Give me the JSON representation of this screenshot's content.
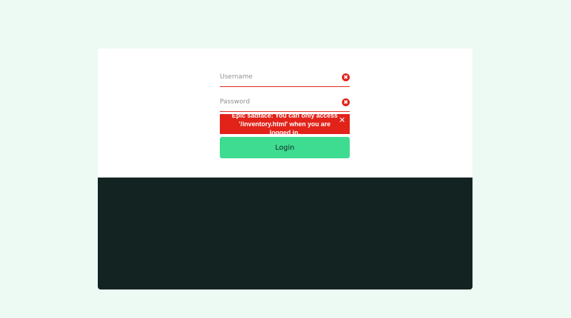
{
  "login": {
    "username_placeholder": "Username",
    "username_value": "",
    "password_placeholder": "Password",
    "password_value": "",
    "error_icon_glyph": "✖",
    "error_message": "Epic sadface: You can only access '/inventory.html' when you are logged in.",
    "error_close_glyph": "✕",
    "login_button_label": "Login"
  },
  "colors": {
    "page_background": "#ecfaf3",
    "card_background": "#ffffff",
    "card_bottom_background": "#132322",
    "error_red": "#e2231a",
    "button_green": "#3ddc91"
  },
  "icons": [
    "error-circle-icon",
    "close-icon"
  ]
}
